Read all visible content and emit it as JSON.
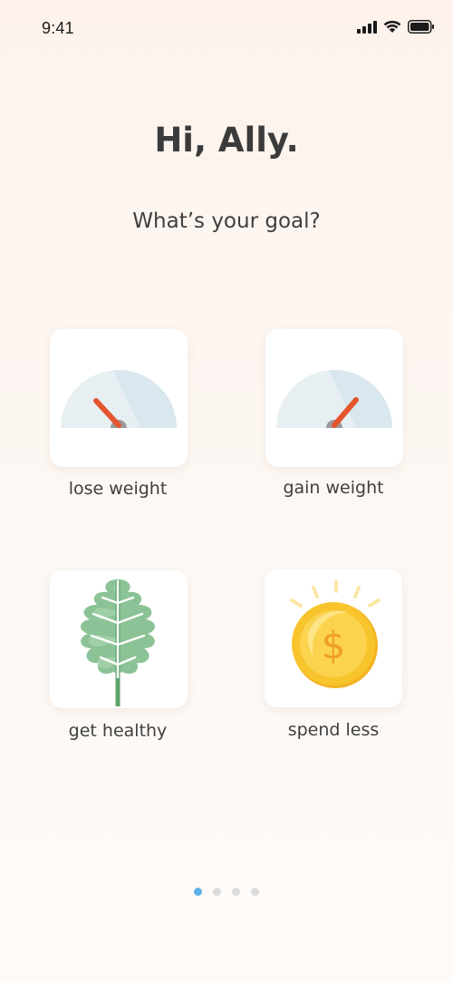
{
  "status_bar": {
    "time": "9:41",
    "icons": [
      "signal-icon",
      "wifi-icon",
      "battery-icon"
    ]
  },
  "greeting": "Hi, Ally.",
  "question": "What’s your goal?",
  "goals": [
    {
      "label": "lose weight",
      "icon": "scale-gauge-icon"
    },
    {
      "label": "gain weight",
      "icon": "scale-gauge-icon"
    },
    {
      "label": "get healthy",
      "icon": "leaf-icon"
    },
    {
      "label": "spend less",
      "icon": "coin-icon",
      "coin_symbol": "$"
    }
  ],
  "pager": {
    "total": 4,
    "active": 1
  },
  "colors": {
    "needle": "#e3552f",
    "gauge_light": "#e7eff2",
    "gauge_dark": "#d8e8ee",
    "leaf": "#8cc396",
    "leaf_dark": "#5da36c",
    "coin": "#f8c42c",
    "coin_symbol": "#f0a024",
    "pager_active": "#5fb0e6"
  }
}
